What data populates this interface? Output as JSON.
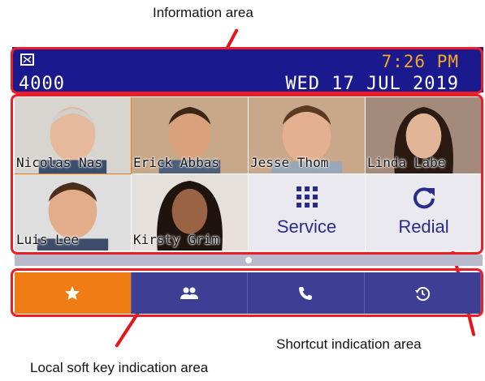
{
  "callouts": {
    "information_area": "Information area",
    "shortcut_area": "Shortcut indication area",
    "softkey_area": "Local soft key indication area"
  },
  "infobar": {
    "status_icon": "voicemail-icon",
    "extension": "4000",
    "time": "7:26 PM",
    "date": "WED 17 JUL 2019"
  },
  "contacts": [
    {
      "label": "Nicolas Nas",
      "selected": true
    },
    {
      "label": "Erick Abbas",
      "selected": false
    },
    {
      "label": "Jesse Thom",
      "selected": false
    },
    {
      "label": "Linda Labe",
      "selected": false
    },
    {
      "label": "Luis Lee",
      "selected": false
    },
    {
      "label": "Kirsty Grim",
      "selected": false
    }
  ],
  "shortcuts": {
    "service": {
      "label": "Service",
      "icon": "grid-icon"
    },
    "redial": {
      "label": "Redial",
      "icon": "redial-icon"
    }
  },
  "softkeys": [
    {
      "icon": "star-icon",
      "active": true
    },
    {
      "icon": "contacts-icon",
      "active": false
    },
    {
      "icon": "phone-icon",
      "active": false
    },
    {
      "icon": "history-icon",
      "active": false
    }
  ],
  "colors": {
    "infobar_bg": "#1a1a8e",
    "time_color": "#f5a623",
    "highlight": "#ee1c25",
    "softkey_bg": "#3e3e94",
    "softkey_active": "#ef7d14"
  }
}
